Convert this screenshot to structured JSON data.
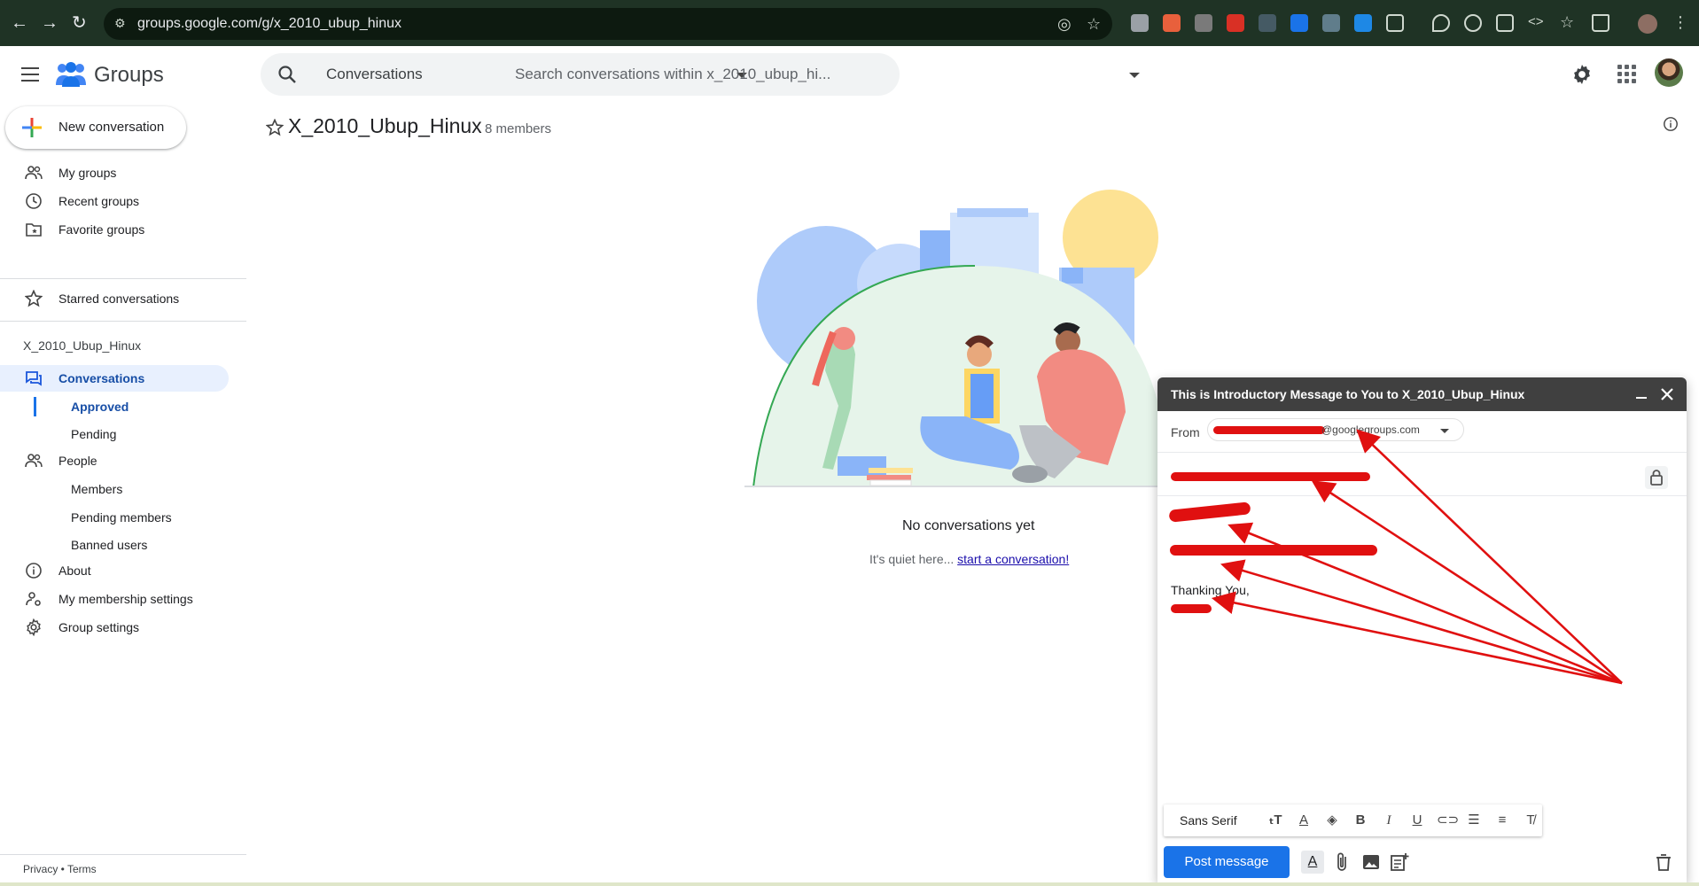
{
  "browser": {
    "url": "groups.google.com/g/x_2010_ubup_hinux"
  },
  "app": {
    "brand": "Groups",
    "search_scope": "Conversations",
    "search_placeholder": "Search conversations within x_2010_ubup_hi..."
  },
  "sidebar": {
    "new_conversation": "New conversation",
    "nav": {
      "my_groups": "My groups",
      "recent_groups": "Recent groups",
      "favorite_groups": "Favorite groups",
      "starred": "Starred conversations"
    },
    "group_name": "X_2010_Ubup_Hinux",
    "group_nav": {
      "conversations": "Conversations",
      "approved": "Approved",
      "pending": "Pending",
      "people": "People",
      "members": "Members",
      "pending_members": "Pending members",
      "banned_users": "Banned users",
      "about": "About",
      "membership_settings": "My membership settings",
      "group_settings": "Group settings"
    },
    "footer": "Privacy • Terms"
  },
  "main": {
    "title": "X_2010_Ubup_Hinux",
    "members": "8 members",
    "empty_title": "No conversations yet",
    "empty_text": "It's quiet here... ",
    "empty_link": "start a conversation!"
  },
  "compose": {
    "title": "This is Introductory Message to You to X_2010_Ubup_Hinux",
    "from_label": "From",
    "from_domain": "@googlegroups.com",
    "body_closing": "Thanking You,",
    "font": "Sans Serif",
    "post_button": "Post message"
  },
  "colors": {
    "accent": "#1a73e8",
    "active_nav_bg": "#e8f0fe",
    "redaction": "#e01010",
    "compose_header": "#404040"
  }
}
